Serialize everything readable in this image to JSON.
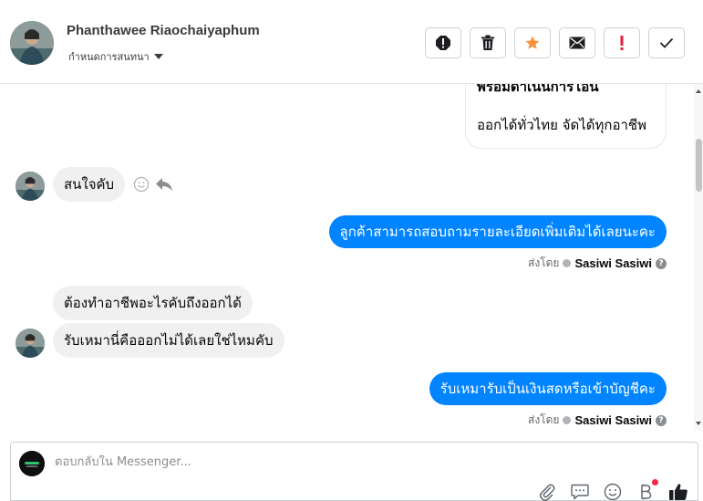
{
  "header": {
    "contact_name": "Phanthawee Riaochaiyaphum",
    "conversation_settings": "กำหนดการสนทนา",
    "toolbar": [
      {
        "name": "spam-button",
        "icon": "alert-circle-icon"
      },
      {
        "name": "delete-button",
        "icon": "trash-icon"
      },
      {
        "name": "star-button",
        "icon": "star-icon"
      },
      {
        "name": "mark-unread-button",
        "icon": "envelope-icon"
      },
      {
        "name": "important-button",
        "icon": "exclamation-icon"
      },
      {
        "name": "done-button",
        "icon": "check-icon"
      }
    ]
  },
  "messages": {
    "card": {
      "title": "พร้อมดำเนินการโอน",
      "subtitle": "ออกได้ทั่วไทย จัดได้ทุกอาชีพ"
    },
    "items": [
      {
        "direction": "incoming",
        "text": "สนใจคับ"
      },
      {
        "direction": "outgoing",
        "text": "ลูกค้าสามารถสอบถามรายละเอียดเพิ่มเติมได้เลยนะคะ"
      },
      {
        "direction": "incoming",
        "text": "ต้องทำอาชีพอะไรคับถึงออกได้"
      },
      {
        "direction": "incoming",
        "text": "รับเหมานี่คือออกไม่ได้เลยใช่ไหมคับ"
      },
      {
        "direction": "outgoing",
        "text": "รับเหมารับเป็นเงินสดหรือเข้าบัญชีคะ"
      }
    ],
    "sent_by_label": "ส่งโดย",
    "sender_name": "Sasiwi Sasiwi"
  },
  "composer": {
    "placeholder": "ตอบกลับใน Messenger...",
    "tools": [
      "paperclip-icon",
      "saved-reply-icon",
      "emoji-icon",
      "bold-b-icon",
      "thumbs-up-icon"
    ]
  },
  "colors": {
    "outgoing_bubble": "#0084ff",
    "incoming_bubble": "#f0f0f0",
    "star": "#f7923b",
    "important": "#e41e3f"
  }
}
